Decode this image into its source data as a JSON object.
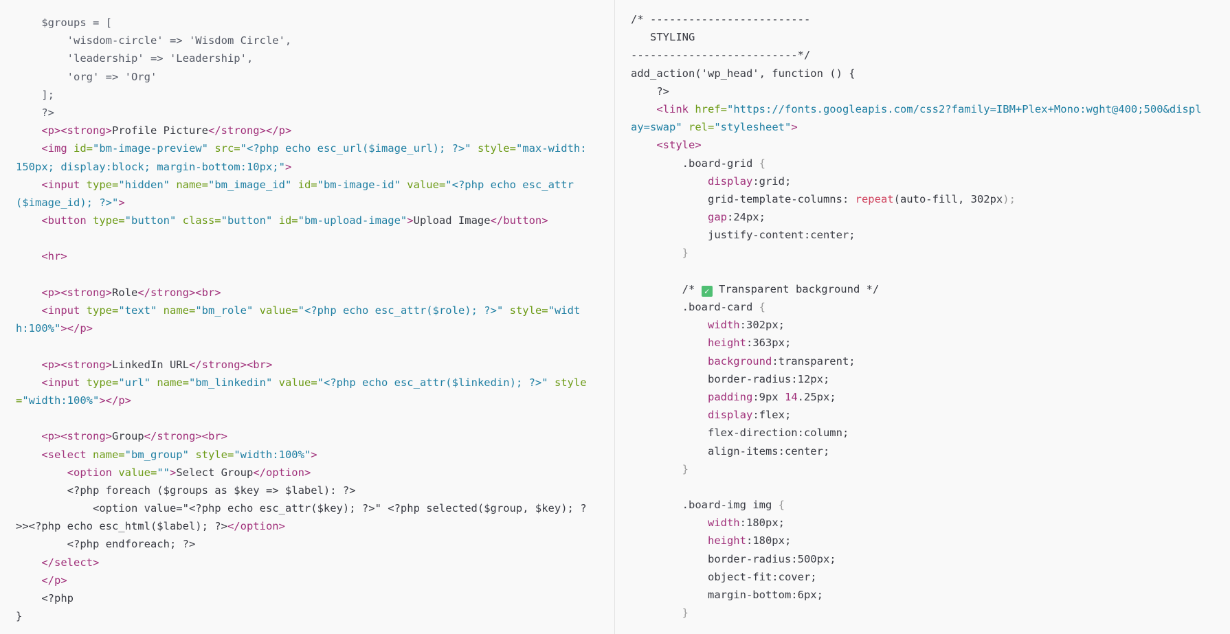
{
  "panes": {
    "left": {
      "lines": [
        [
          [
            "    ",
            "plain"
          ],
          [
            "$groups = [",
            "php"
          ]
        ],
        [
          [
            "        'wisdom-circle' => 'Wisdom Circle',",
            "php"
          ]
        ],
        [
          [
            "        'leadership' => 'Leadership',",
            "php"
          ]
        ],
        [
          [
            "        'org' => 'Org'",
            "php"
          ]
        ],
        [
          [
            "    ];",
            "php"
          ]
        ],
        [
          [
            "    ?>",
            "php"
          ]
        ],
        [
          [
            "    ",
            "plain"
          ],
          [
            "<p><strong>",
            "tag"
          ],
          [
            "Profile Picture",
            "plain"
          ],
          [
            "</strong></p>",
            "tag"
          ]
        ],
        [
          [
            "    ",
            "plain"
          ],
          [
            "<img ",
            "tag"
          ],
          [
            "id=",
            "attr"
          ],
          [
            "\"bm-image-preview\"",
            "str"
          ],
          [
            " src=",
            "attr"
          ],
          [
            "\"<?php echo esc_url($image_url); ?>\"",
            "str"
          ],
          [
            " style=",
            "attr"
          ],
          [
            "\"max-width:",
            "str"
          ]
        ],
        [
          [
            "150px; display:block; margin-bottom:10px;\"",
            "str"
          ],
          [
            ">",
            "tag"
          ]
        ],
        [
          [
            "    ",
            "plain"
          ],
          [
            "<input ",
            "tag"
          ],
          [
            "type=",
            "attr"
          ],
          [
            "\"hidden\"",
            "str"
          ],
          [
            " name=",
            "attr"
          ],
          [
            "\"bm_image_id\"",
            "str"
          ],
          [
            " id=",
            "attr"
          ],
          [
            "\"bm-image-id\"",
            "str"
          ],
          [
            " value=",
            "attr"
          ],
          [
            "\"<?php echo esc_attr",
            "str"
          ]
        ],
        [
          [
            "($image_id); ?>\"",
            "str"
          ],
          [
            ">",
            "tag"
          ]
        ],
        [
          [
            "    ",
            "plain"
          ],
          [
            "<button ",
            "tag"
          ],
          [
            "type=",
            "attr"
          ],
          [
            "\"button\"",
            "str"
          ],
          [
            " class=",
            "attr"
          ],
          [
            "\"button\"",
            "str"
          ],
          [
            " id=",
            "attr"
          ],
          [
            "\"bm-upload-image\"",
            "str"
          ],
          [
            ">",
            "tag"
          ],
          [
            "Upload Image",
            "plain"
          ],
          [
            "</button>",
            "tag"
          ]
        ],
        [
          [
            "",
            "plain"
          ]
        ],
        [
          [
            "    ",
            "plain"
          ],
          [
            "<hr>",
            "tag"
          ]
        ],
        [
          [
            "",
            "plain"
          ]
        ],
        [
          [
            "    ",
            "plain"
          ],
          [
            "<p><strong>",
            "tag"
          ],
          [
            "Role",
            "plain"
          ],
          [
            "</strong><br>",
            "tag"
          ]
        ],
        [
          [
            "    ",
            "plain"
          ],
          [
            "<input ",
            "tag"
          ],
          [
            "type=",
            "attr"
          ],
          [
            "\"text\"",
            "str"
          ],
          [
            " name=",
            "attr"
          ],
          [
            "\"bm_role\"",
            "str"
          ],
          [
            " value=",
            "attr"
          ],
          [
            "\"<?php echo esc_attr($role); ?>\"",
            "str"
          ],
          [
            " style=",
            "attr"
          ],
          [
            "\"widt",
            "str"
          ]
        ],
        [
          [
            "h:100%\"",
            "str"
          ],
          [
            "></p>",
            "tag"
          ]
        ],
        [
          [
            "",
            "plain"
          ]
        ],
        [
          [
            "    ",
            "plain"
          ],
          [
            "<p><strong>",
            "tag"
          ],
          [
            "LinkedIn URL",
            "plain"
          ],
          [
            "</strong><br>",
            "tag"
          ]
        ],
        [
          [
            "    ",
            "plain"
          ],
          [
            "<input ",
            "tag"
          ],
          [
            "type=",
            "attr"
          ],
          [
            "\"url\"",
            "str"
          ],
          [
            " name=",
            "attr"
          ],
          [
            "\"bm_linkedin\"",
            "str"
          ],
          [
            " value=",
            "attr"
          ],
          [
            "\"<?php echo esc_attr($linkedin); ?>\"",
            "str"
          ],
          [
            " style",
            "attr"
          ]
        ],
        [
          [
            "=",
            "attr"
          ],
          [
            "\"width:100%\"",
            "str"
          ],
          [
            "></p>",
            "tag"
          ]
        ],
        [
          [
            "",
            "plain"
          ]
        ],
        [
          [
            "    ",
            "plain"
          ],
          [
            "<p><strong>",
            "tag"
          ],
          [
            "Group",
            "plain"
          ],
          [
            "</strong><br>",
            "tag"
          ]
        ],
        [
          [
            "    ",
            "plain"
          ],
          [
            "<select ",
            "tag"
          ],
          [
            "name=",
            "attr"
          ],
          [
            "\"bm_group\"",
            "str"
          ],
          [
            " style=",
            "attr"
          ],
          [
            "\"width:100%\"",
            "str"
          ],
          [
            ">",
            "tag"
          ]
        ],
        [
          [
            "        ",
            "plain"
          ],
          [
            "<option ",
            "tag"
          ],
          [
            "value=",
            "attr"
          ],
          [
            "\"\"",
            "str"
          ],
          [
            ">",
            "tag"
          ],
          [
            "Select Group",
            "plain"
          ],
          [
            "</option>",
            "tag"
          ]
        ],
        [
          [
            "        <?php foreach ($groups as $key => $label): ?>",
            "plain"
          ]
        ],
        [
          [
            "            <option value=\"<?php echo esc_attr($key); ?>\" <?php selected($group, $key); ?",
            "plain"
          ]
        ],
        [
          [
            ">><?php echo esc_html($label); ?>",
            "plain"
          ],
          [
            "</option>",
            "tag"
          ]
        ],
        [
          [
            "        <?php endforeach; ?>",
            "plain"
          ]
        ],
        [
          [
            "    ",
            "plain"
          ],
          [
            "</select>",
            "tag"
          ]
        ],
        [
          [
            "    ",
            "plain"
          ],
          [
            "</p>",
            "tag"
          ]
        ],
        [
          [
            "    <?php",
            "plain"
          ]
        ],
        [
          [
            "}",
            "plain"
          ]
        ]
      ]
    },
    "right": {
      "lines": [
        [
          [
            "/* -------------------------",
            "cmt"
          ]
        ],
        [
          [
            "   STYLING",
            "cmt"
          ]
        ],
        [
          [
            "--------------------------*/",
            "cmt"
          ]
        ],
        [
          [
            "add_action('wp_head', function () {",
            "plain"
          ]
        ],
        [
          [
            "    ?>",
            "plain"
          ]
        ],
        [
          [
            "    ",
            "plain"
          ],
          [
            "<link ",
            "tag"
          ],
          [
            "href=",
            "attr"
          ],
          [
            "\"https://fonts.googleapis.com/css2?family=IBM+Plex+Mono:wght@400;500&displ",
            "str"
          ]
        ],
        [
          [
            "ay=swap\"",
            "str"
          ],
          [
            " rel=",
            "attr"
          ],
          [
            "\"stylesheet\"",
            "str"
          ],
          [
            ">",
            "tag"
          ]
        ],
        [
          [
            "    ",
            "plain"
          ],
          [
            "<style>",
            "tag"
          ]
        ],
        [
          [
            "        .board-grid ",
            "plain"
          ],
          [
            "{",
            "punc"
          ]
        ],
        [
          [
            "            ",
            "plain"
          ],
          [
            "display",
            "prop"
          ],
          [
            ":grid;",
            "plain"
          ]
        ],
        [
          [
            "            grid-template-columns: ",
            "plain"
          ],
          [
            "repeat",
            "fn"
          ],
          [
            "(auto-fill, 302px",
            "plain"
          ],
          [
            ");",
            "punc"
          ]
        ],
        [
          [
            "            ",
            "plain"
          ],
          [
            "gap",
            "prop"
          ],
          [
            ":24px;",
            "plain"
          ]
        ],
        [
          [
            "            justify-content:center;",
            "plain"
          ]
        ],
        [
          [
            "        ",
            "plain"
          ],
          [
            "}",
            "punc"
          ]
        ],
        [
          [
            "",
            "plain"
          ]
        ],
        [
          [
            "        /* ",
            "cmt"
          ],
          [
            "✓",
            "emoji"
          ],
          [
            " Transparent background */",
            "cmt"
          ]
        ],
        [
          [
            "        .board-card ",
            "plain"
          ],
          [
            "{",
            "punc"
          ]
        ],
        [
          [
            "            ",
            "plain"
          ],
          [
            "width",
            "prop"
          ],
          [
            ":302px;",
            "plain"
          ]
        ],
        [
          [
            "            ",
            "plain"
          ],
          [
            "height",
            "prop"
          ],
          [
            ":363px;",
            "plain"
          ]
        ],
        [
          [
            "            ",
            "plain"
          ],
          [
            "background",
            "prop"
          ],
          [
            ":transparent;",
            "plain"
          ]
        ],
        [
          [
            "            border-radius:12px;",
            "plain"
          ]
        ],
        [
          [
            "            ",
            "plain"
          ],
          [
            "padding",
            "prop"
          ],
          [
            ":9px ",
            "plain"
          ],
          [
            "14",
            "num"
          ],
          [
            ".25px;",
            "plain"
          ]
        ],
        [
          [
            "            ",
            "plain"
          ],
          [
            "display",
            "prop"
          ],
          [
            ":flex;",
            "plain"
          ]
        ],
        [
          [
            "            flex-direction:column;",
            "plain"
          ]
        ],
        [
          [
            "            align-items:center;",
            "plain"
          ]
        ],
        [
          [
            "        ",
            "plain"
          ],
          [
            "}",
            "punc"
          ]
        ],
        [
          [
            "",
            "plain"
          ]
        ],
        [
          [
            "        .board-img img ",
            "plain"
          ],
          [
            "{",
            "punc"
          ]
        ],
        [
          [
            "            ",
            "plain"
          ],
          [
            "width",
            "prop"
          ],
          [
            ":180px;",
            "plain"
          ]
        ],
        [
          [
            "            ",
            "plain"
          ],
          [
            "height",
            "prop"
          ],
          [
            ":180px;",
            "plain"
          ]
        ],
        [
          [
            "            border-radius:500px;",
            "plain"
          ]
        ],
        [
          [
            "            object-fit:cover;",
            "plain"
          ]
        ],
        [
          [
            "            margin-bottom:6px;",
            "plain"
          ]
        ],
        [
          [
            "        ",
            "plain"
          ],
          [
            "}",
            "punc"
          ]
        ]
      ]
    }
  }
}
